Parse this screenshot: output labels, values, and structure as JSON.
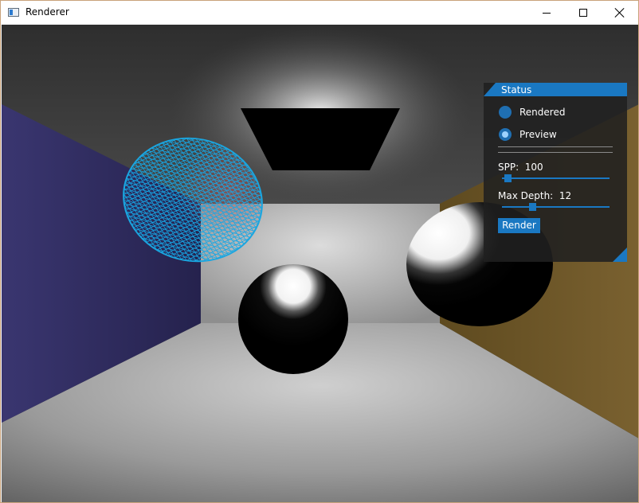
{
  "window": {
    "title": "Renderer"
  },
  "status_panel": {
    "title": "Status",
    "mode_options": [
      {
        "label": "Rendered",
        "selected": false
      },
      {
        "label": "Preview",
        "selected": true
      }
    ],
    "spp": {
      "label": "SPP:",
      "value": "100",
      "fill_fraction": 0.02
    },
    "max_depth": {
      "label": "Max Depth:",
      "value": "12",
      "fill_fraction": 0.27
    },
    "render_button_label": "Render"
  },
  "colors": {
    "accent": "#1a78c2",
    "wireframe": "#16a8e6",
    "left_wall": "#2f2c60",
    "right_wall": "#6b5526"
  },
  "icons": {
    "app": "window-app-icon",
    "minimize": "minimize-icon",
    "maximize": "maximize-icon",
    "close": "close-icon"
  }
}
